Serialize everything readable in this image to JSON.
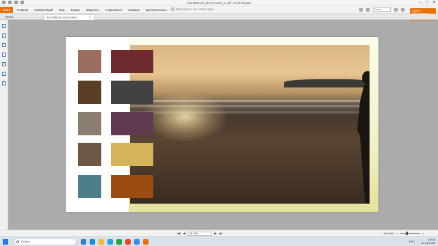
{
  "window": {
    "title": "KOLORBUK_SLAYYIASH_1.pdf - Foxit Reader",
    "controls": [
      "–",
      "□",
      "✕"
    ]
  },
  "menu": {
    "file_label": "Файл",
    "items": [
      "Главная",
      "Комментарий",
      "Вид",
      "Форма",
      "Защитить",
      "Поделиться",
      "Справка",
      "Дополнительно"
    ],
    "tell_me": "Расскажите, что хотите сдел",
    "search_placeholder": "Поиск"
  },
  "promo": {
    "line1": "Convert",
    "line2": "PDF to images"
  },
  "tabs": [
    {
      "label": "Начать"
    },
    {
      "label": "KOLORBUK_SLAYYIASH..."
    }
  ],
  "document": {
    "swatches": [
      {
        "color": "#9b6e5f"
      },
      {
        "color": "#6e2a2d"
      },
      {
        "color": "#5a3f26"
      },
      {
        "color": "#424245"
      },
      {
        "color": "#8c7e71"
      },
      {
        "color": "#5f3a50"
      },
      {
        "color": "#6c5844"
      },
      {
        "color": "#d4b45a"
      },
      {
        "color": "#4d7e8a"
      },
      {
        "color": "#9a4c12"
      }
    ]
  },
  "statusbar": {
    "page_indicator": "28 / 66",
    "zoom": "196,60%"
  },
  "taskbar": {
    "search_placeholder": "Поиск",
    "time": "20:30",
    "date": "01.05.2025",
    "lang": "РУС"
  }
}
